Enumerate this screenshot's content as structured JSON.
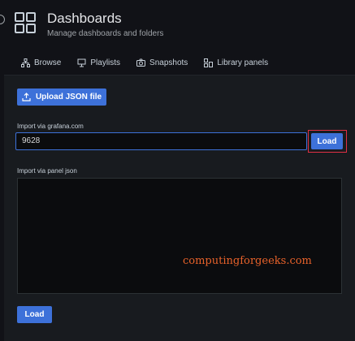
{
  "header": {
    "title": "Dashboards",
    "subtitle": "Manage dashboards and folders",
    "icon": "dashboard-grid-icon"
  },
  "tabs": [
    {
      "label": "Browse",
      "icon": "sitemap-icon"
    },
    {
      "label": "Playlists",
      "icon": "presentation-icon"
    },
    {
      "label": "Snapshots",
      "icon": "camera-icon"
    },
    {
      "label": "Library panels",
      "icon": "library-panels-icon"
    }
  ],
  "import": {
    "upload_label": "Upload JSON file",
    "grafana_label": "Import via grafana.com",
    "grafana_value": "9628",
    "load_label": "Load",
    "panel_json_label": "Import via panel json",
    "panel_json_value": "",
    "load_bottom_label": "Load"
  },
  "watermark": "computingforgeeks.com",
  "colors": {
    "background": "#111217",
    "panel": "#181b1f",
    "primary": "#3d71d9",
    "highlight": "#e02f44",
    "watermark": "#e8622a"
  }
}
